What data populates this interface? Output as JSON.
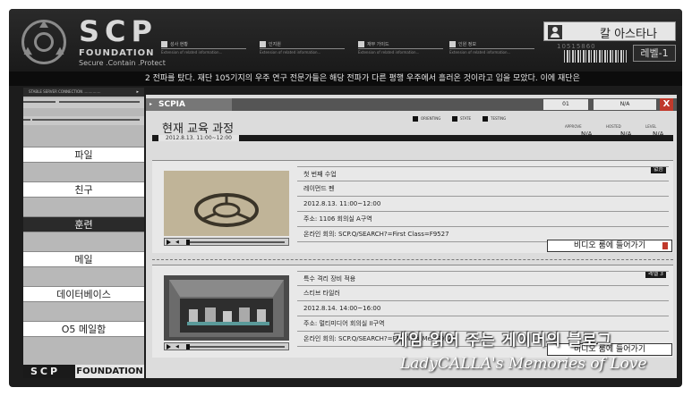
{
  "header": {
    "brand": "SCP",
    "brand_sub": "FOUNDATION",
    "brand_tagline": "Secure .Contain .Protect",
    "blocks": [
      {
        "label": "성사 현황",
        "detail": "Extension of related information..."
      },
      {
        "label": "인지원",
        "detail": "Extension of related information..."
      },
      {
        "label": "재무 가이드",
        "detail": "Extension of related information..."
      },
      {
        "label": "인원 정보",
        "detail": "Extension of related information..."
      }
    ],
    "user_name": "칼 아스타나",
    "user_id": "10515860",
    "level": "레벨-1"
  },
  "ticker": "2 전파를 탔다. 재단 105기지의 우주 연구 전문가들은 해당 전파가 다른 평행 우주에서 흘러온 것이라고 입을 모았다. 이에 재단은",
  "sidebar": {
    "top_label": "STABLE SERVER CONNECTION ...............",
    "items": [
      {
        "label": "파일"
      },
      {
        "label": "친구"
      },
      {
        "label": "훈련"
      },
      {
        "label": "메일"
      },
      {
        "label": "데이터베이스"
      },
      {
        "label": "O5 메일함"
      }
    ],
    "footer_scp": "SCP",
    "footer_foundation": "FOUNDATION"
  },
  "main": {
    "tab": "SCPIA",
    "tab_num": "01",
    "tab_na": "N/A",
    "close": "X",
    "title": "현재 교육 과정",
    "title_date": "2012.8.13. 11:00~12:00",
    "legend": [
      "ORIENTING",
      "STATE",
      "TESTING"
    ],
    "stats": [
      {
        "label": "APPROVE",
        "value": "N/A"
      },
      {
        "label": "HOSTED",
        "value": "N/A"
      },
      {
        "label": "LEVEL",
        "value": "N/A"
      }
    ],
    "cards": [
      {
        "badge": "없음",
        "rows": [
          "첫 번째 수업",
          "레이먼드 펜",
          "2012.8.13. 11:00~12:00",
          "주소: 1106 회의실 A구역",
          "온라인 회의: SCP.Q/SEARCH?=First Class=F9527"
        ],
        "join": "비디오 룸에 들어가기"
      },
      {
        "badge": "레벨 3",
        "rows": [
          "특수 격리 장비 적용",
          "스티브 타일러",
          "2012.8.14. 14:00~16:00",
          "주소: 멀티미디어 회의실 II구역",
          "온라인 회의: SCP.Q/SEARCH?=Fly_With_Me=F9527"
        ],
        "join": "비디오 룸에 들어가기"
      }
    ]
  },
  "watermark": {
    "line1": "게임 읽어 주는 게이머의 블로그",
    "line2": "LadyCALLA's Memories of Love"
  }
}
